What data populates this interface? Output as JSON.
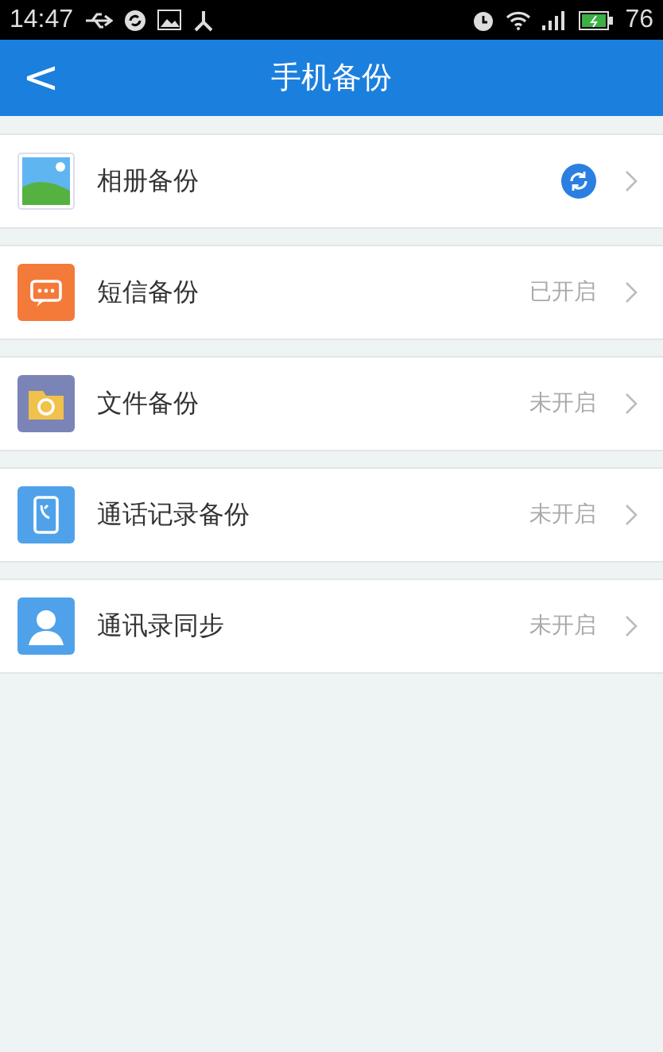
{
  "status_bar": {
    "time": "14:47",
    "battery": "76"
  },
  "header": {
    "title": "手机备份",
    "back": "<"
  },
  "items": [
    {
      "label": "相册备份",
      "kind": "picture",
      "status": {
        "kind": "syncing"
      }
    },
    {
      "label": "短信备份",
      "kind": "message",
      "status": {
        "kind": "text",
        "text": "已开启"
      }
    },
    {
      "label": "文件备份",
      "kind": "folder",
      "status": {
        "kind": "text",
        "text": "未开启"
      }
    },
    {
      "label": "通话记录备份",
      "kind": "call",
      "status": {
        "kind": "text",
        "text": "未开启"
      }
    },
    {
      "label": "通讯录同步",
      "kind": "contact",
      "status": {
        "kind": "text",
        "text": "未开启"
      }
    }
  ]
}
